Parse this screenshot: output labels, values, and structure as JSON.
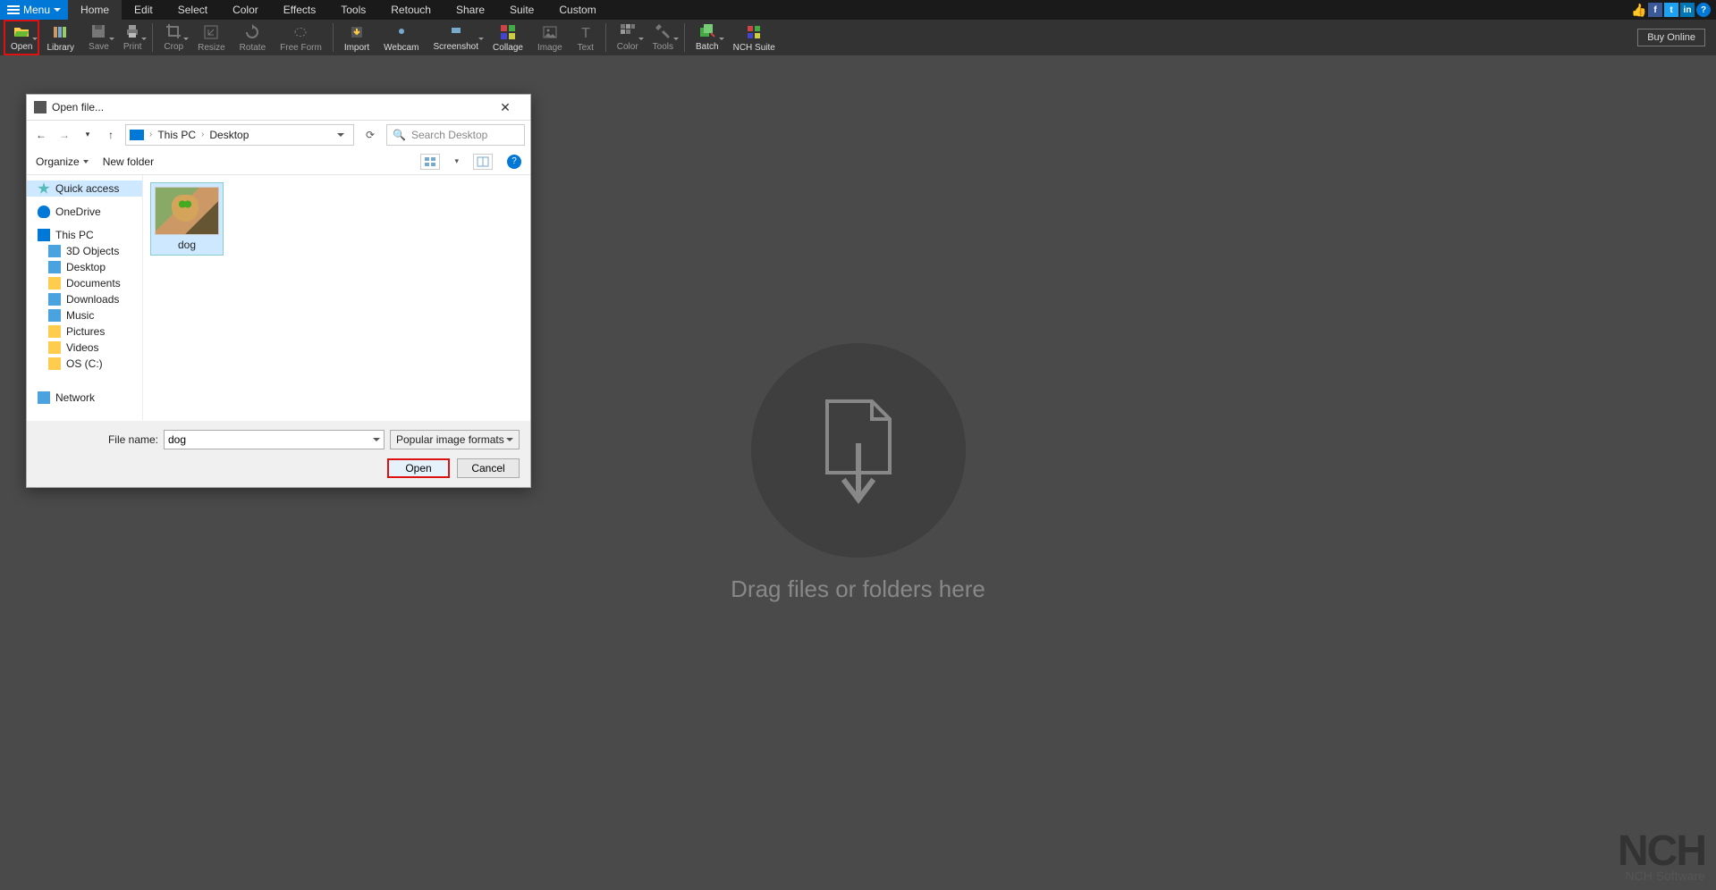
{
  "menubar": {
    "menu_label": "Menu",
    "tabs": [
      "Home",
      "Edit",
      "Select",
      "Color",
      "Effects",
      "Tools",
      "Retouch",
      "Share",
      "Suite",
      "Custom"
    ],
    "active_tab": 0
  },
  "ribbon": {
    "items": [
      {
        "label": "Open",
        "enabled": true,
        "caret": true,
        "highlight": true
      },
      {
        "label": "Library",
        "enabled": true
      },
      {
        "label": "Save",
        "enabled": false,
        "caret": true
      },
      {
        "label": "Print",
        "enabled": false,
        "caret": true
      },
      {
        "sep": true
      },
      {
        "label": "Crop",
        "enabled": false,
        "caret": true
      },
      {
        "label": "Resize",
        "enabled": false
      },
      {
        "label": "Rotate",
        "enabled": false
      },
      {
        "label": "Free Form",
        "enabled": false
      },
      {
        "sep": true
      },
      {
        "label": "Import",
        "enabled": true
      },
      {
        "label": "Webcam",
        "enabled": true
      },
      {
        "label": "Screenshot",
        "enabled": true,
        "caret": true
      },
      {
        "label": "Collage",
        "enabled": true
      },
      {
        "label": "Image",
        "enabled": false
      },
      {
        "label": "Text",
        "enabled": false
      },
      {
        "sep": true
      },
      {
        "label": "Color",
        "enabled": false,
        "caret": true
      },
      {
        "label": "Tools",
        "enabled": false,
        "caret": true
      },
      {
        "sep": true
      },
      {
        "label": "Batch",
        "enabled": true,
        "caret": true
      },
      {
        "label": "NCH Suite",
        "enabled": true
      }
    ],
    "buy_label": "Buy Online"
  },
  "canvas": {
    "drop_text": "Drag files or folders here"
  },
  "watermark": {
    "big": "NCH",
    "small": "NCH Software"
  },
  "dialog": {
    "title": "Open file...",
    "breadcrumb": [
      "This PC",
      "Desktop"
    ],
    "search_placeholder": "Search Desktop",
    "organize": "Organize",
    "new_folder": "New folder",
    "tree": [
      {
        "label": "Quick access",
        "icon": "star",
        "sel": true
      },
      {
        "label": "OneDrive",
        "icon": "cloud"
      },
      {
        "label": "This PC",
        "icon": "pc"
      },
      {
        "label": "3D Objects",
        "icon": "blue",
        "sub": true
      },
      {
        "label": "Desktop",
        "icon": "blue",
        "sub": true
      },
      {
        "label": "Documents",
        "icon": "folder",
        "sub": true
      },
      {
        "label": "Downloads",
        "icon": "blue",
        "sub": true
      },
      {
        "label": "Music",
        "icon": "blue",
        "sub": true
      },
      {
        "label": "Pictures",
        "icon": "folder",
        "sub": true
      },
      {
        "label": "Videos",
        "icon": "folder",
        "sub": true
      },
      {
        "label": "OS (C:)",
        "icon": "folder",
        "sub": true
      },
      {
        "label": "Network",
        "icon": "net"
      }
    ],
    "file": {
      "name": "dog"
    },
    "filename_label": "File name:",
    "filename_value": "dog",
    "filter_label": "Popular image formats",
    "open_btn": "Open",
    "cancel_btn": "Cancel"
  }
}
